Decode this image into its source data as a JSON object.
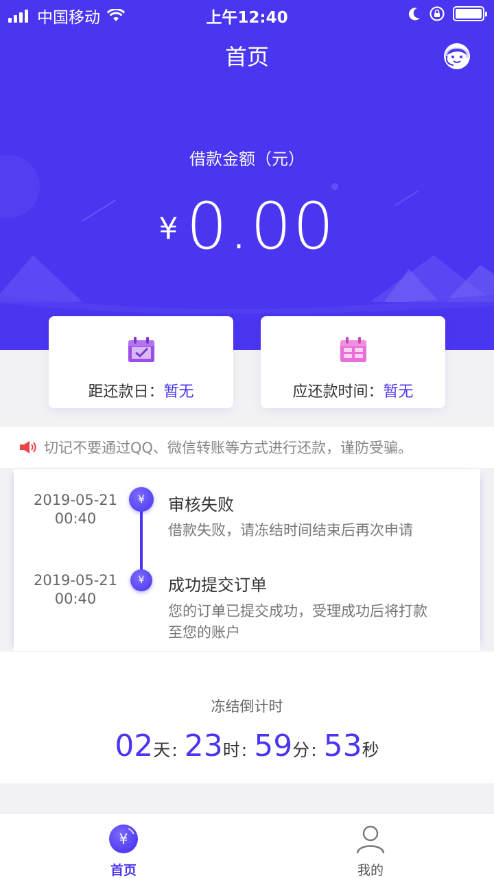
{
  "status_bar": {
    "carrier": "中国移动",
    "time": "上午12:40"
  },
  "header": {
    "title": "首页",
    "service_icon": "customer-service-icon"
  },
  "loan": {
    "label": "借款金额（元）",
    "currency_symbol": "¥",
    "amount": "0.00"
  },
  "cards": {
    "days_until_due": {
      "label": "距还款日：",
      "value": "暂无",
      "icon": "calendar-check-icon"
    },
    "due_time": {
      "label": "应还款时间：",
      "value": "暂无",
      "icon": "calendar-icon"
    }
  },
  "notice": {
    "icon": "speaker-icon",
    "text": "切记不要通过QQ、微信转账等方式进行还款，谨防受骗。"
  },
  "timeline": [
    {
      "date": "2019-05-21",
      "time": "00:40",
      "title": "审核失败",
      "description": "借款失败，请冻结时间结束后再次申请"
    },
    {
      "date": "2019-05-21",
      "time": "00:40",
      "title": "成功提交订单",
      "description_line1": "您的订单已提交成功，受理成功后将打款",
      "description_line2": "至您的账户"
    }
  ],
  "countdown": {
    "label": "冻结倒计时",
    "days": "02",
    "days_unit": "天",
    "hours": "23",
    "hours_unit": "时",
    "minutes": "59",
    "minutes_unit": "分",
    "seconds": "53",
    "seconds_unit": "秒",
    "separator": ":"
  },
  "tabbar": {
    "home": "首页",
    "me": "我的"
  },
  "colors": {
    "accent": "#4a35f0",
    "calendar_purple": "#9b4fe6",
    "calendar_pink": "#e86fd8",
    "notice_red": "#e8454a"
  }
}
